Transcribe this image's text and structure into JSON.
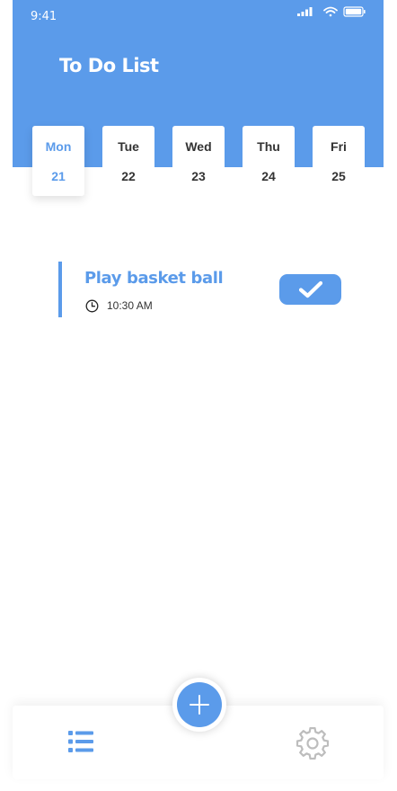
{
  "status_bar": {
    "time": "9:41",
    "icons": [
      "signal-icon",
      "wifi-icon",
      "battery-icon"
    ]
  },
  "header": {
    "title": "To Do List"
  },
  "days": [
    {
      "name": "Mon",
      "date": "21",
      "selected": true
    },
    {
      "name": "Tue",
      "date": "22",
      "selected": false
    },
    {
      "name": "Wed",
      "date": "23",
      "selected": false
    },
    {
      "name": "Thu",
      "date": "24",
      "selected": false
    },
    {
      "name": "Fri",
      "date": "25",
      "selected": false
    }
  ],
  "tasks": [
    {
      "title": "Play basket ball",
      "time": "10:30 AM",
      "icon": "clock-icon",
      "done_icon": "checkmark-icon"
    }
  ],
  "bottom_nav": {
    "items": [
      {
        "icon": "list-icon",
        "active": true
      },
      {
        "icon": "gear-icon",
        "active": false
      }
    ],
    "fab_icon": "plus-icon"
  },
  "colors": {
    "accent": "#5b9bea",
    "text_dark": "#333333",
    "inactive_icon": "#bdbdbd",
    "background": "#ffffff"
  }
}
